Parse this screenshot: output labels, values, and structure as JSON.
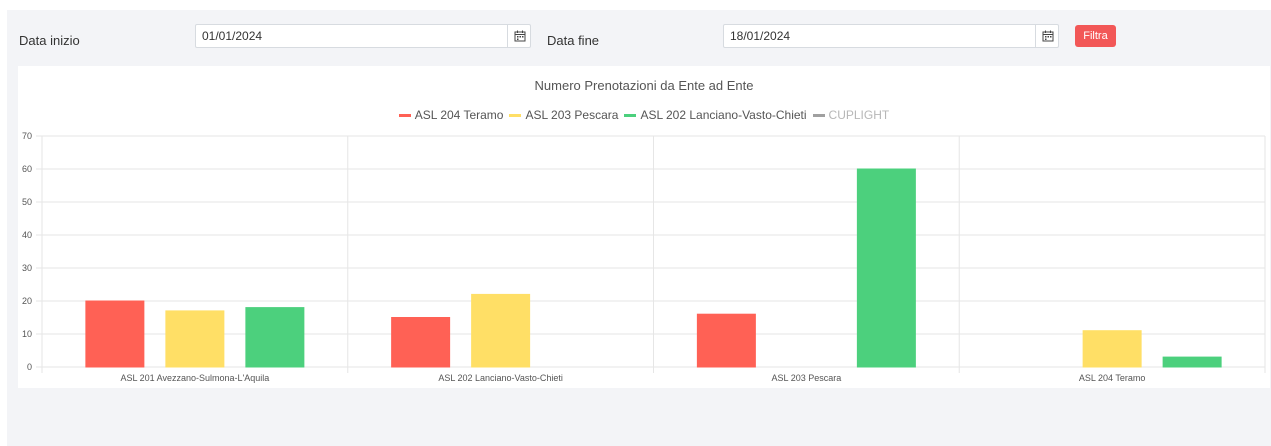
{
  "filters": {
    "start_label": "Data inizio",
    "start_value": "01/01/2024",
    "end_label": "Data fine",
    "end_value": "18/01/2024",
    "filter_button": "Filtra",
    "calendar_icon": "calendar-icon"
  },
  "colors": {
    "panel_bg": "#f3f4f7",
    "filter_button": "#f25757",
    "series": [
      "#ff6155",
      "#ffdf66",
      "#4cd07d",
      "#a0a0a0"
    ]
  },
  "chart_data": {
    "type": "bar",
    "title": "Numero Prenotazioni da Ente ad Ente",
    "categories": [
      "ASL 201 Avezzano-Sulmona-L'Aquila",
      "ASL 202 Lanciano-Vasto-Chieti",
      "ASL 203 Pescara",
      "ASL 204 Teramo"
    ],
    "series": [
      {
        "name": "ASL 204 Teramo",
        "values": [
          20,
          15,
          16,
          0
        ],
        "color": "#ff6155",
        "visible": true
      },
      {
        "name": "ASL 203 Pescara",
        "values": [
          17,
          22,
          0,
          11
        ],
        "color": "#ffdf66",
        "visible": true
      },
      {
        "name": "ASL 202 Lanciano-Vasto-Chieti",
        "values": [
          18,
          0,
          60,
          3
        ],
        "color": "#4cd07d",
        "visible": true
      },
      {
        "name": "CUPLIGHT",
        "values": [],
        "color": "#a0a0a0",
        "visible": false
      }
    ],
    "ylim": [
      0,
      70
    ],
    "yticks": [
      0,
      10,
      20,
      30,
      40,
      50,
      60,
      70
    ],
    "grid": true,
    "legend_position": "top"
  }
}
